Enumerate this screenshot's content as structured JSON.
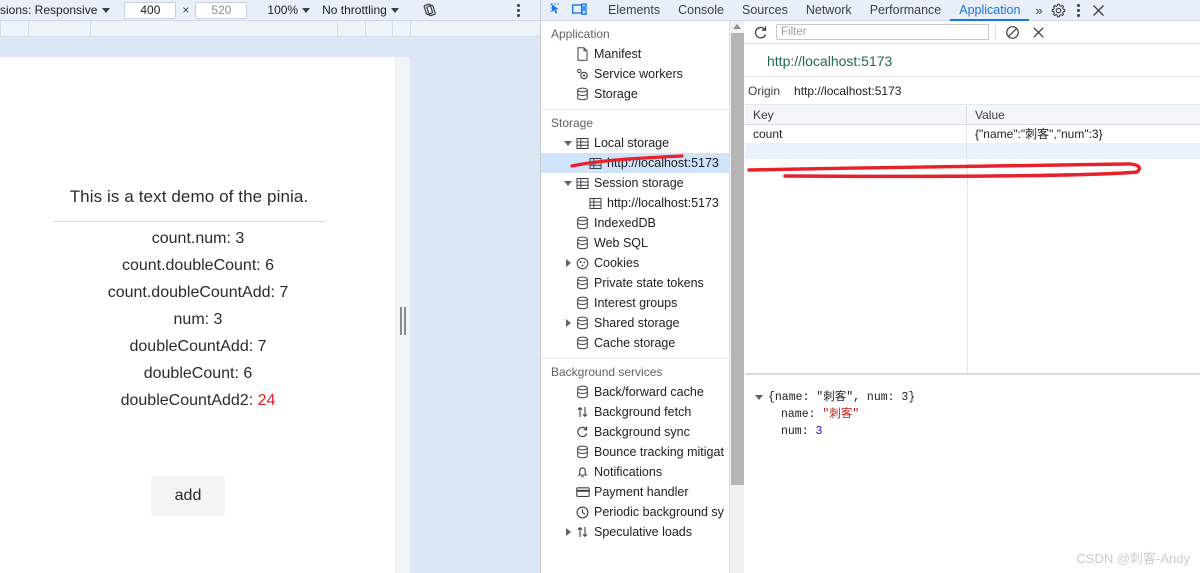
{
  "device_toolbar": {
    "dimensions_label": "sions: Responsive",
    "width_value": "400",
    "height_value": "520",
    "multiply_symbol": "×",
    "zoom_label": "100%",
    "throttling_label": "No throttling",
    "rotate_icon": "rotate-icon",
    "more_icon": "kebab-menu-icon"
  },
  "page": {
    "title": "This is a text demo of the pinia.",
    "stats": [
      {
        "text": "count.num: 3"
      },
      {
        "text": "count.doubleCount: 6"
      },
      {
        "text": "count.doubleCountAdd: 7"
      },
      {
        "text": "num: 3"
      },
      {
        "text": "doubleCountAdd: 7"
      },
      {
        "text": "doubleCount: 6"
      }
    ],
    "accent_stat_label": "doubleCountAdd2: ",
    "accent_stat_value": "24",
    "accent_color": "#e02020",
    "add_button_label": "add"
  },
  "devtools": {
    "inspect_icon": "inspect-element-icon",
    "device_toggle_icon": "device-toolbar-icon",
    "tabs": [
      {
        "label": "Elements",
        "active": false
      },
      {
        "label": "Console",
        "active": false
      },
      {
        "label": "Sources",
        "active": false
      },
      {
        "label": "Network",
        "active": false
      },
      {
        "label": "Performance",
        "active": false
      },
      {
        "label": "Application",
        "active": true
      }
    ],
    "more_tabs_label": "»",
    "settings_icon": "gear-icon",
    "menu_icon": "kebab-menu-icon",
    "close_icon": "close-icon",
    "active_tab_color": "#1a73e8"
  },
  "sidebar": {
    "sections": [
      {
        "title": "Application",
        "items": [
          {
            "label": "Manifest",
            "icon": "document-icon",
            "indent": 1,
            "arrow": "none",
            "selected": false
          },
          {
            "label": "Service workers",
            "icon": "gears-icon",
            "indent": 1,
            "arrow": "none",
            "selected": false
          },
          {
            "label": "Storage",
            "icon": "database-icon",
            "indent": 1,
            "arrow": "none",
            "selected": false
          }
        ]
      },
      {
        "title": "Storage",
        "items": [
          {
            "label": "Local storage",
            "icon": "table-icon",
            "indent": 1,
            "arrow": "open",
            "selected": false
          },
          {
            "label": "http://localhost:5173",
            "icon": "table-icon",
            "indent": 2,
            "arrow": "none",
            "selected": true
          },
          {
            "label": "Session storage",
            "icon": "table-icon",
            "indent": 1,
            "arrow": "open",
            "selected": false
          },
          {
            "label": "http://localhost:5173",
            "icon": "table-icon",
            "indent": 2,
            "arrow": "none",
            "selected": false
          },
          {
            "label": "IndexedDB",
            "icon": "database-icon",
            "indent": 1,
            "arrow": "none",
            "selected": false
          },
          {
            "label": "Web SQL",
            "icon": "database-icon",
            "indent": 1,
            "arrow": "none",
            "selected": false
          },
          {
            "label": "Cookies",
            "icon": "cookie-icon",
            "indent": 1,
            "arrow": "closed",
            "selected": false
          },
          {
            "label": "Private state tokens",
            "icon": "database-icon",
            "indent": 1,
            "arrow": "none",
            "selected": false
          },
          {
            "label": "Interest groups",
            "icon": "database-icon",
            "indent": 1,
            "arrow": "none",
            "selected": false
          },
          {
            "label": "Shared storage",
            "icon": "database-icon",
            "indent": 1,
            "arrow": "closed",
            "selected": false
          },
          {
            "label": "Cache storage",
            "icon": "database-icon",
            "indent": 1,
            "arrow": "none",
            "selected": false
          }
        ]
      },
      {
        "title": "Background services",
        "items": [
          {
            "label": "Back/forward cache",
            "icon": "database-icon",
            "indent": 1,
            "arrow": "none",
            "selected": false
          },
          {
            "label": "Background fetch",
            "icon": "arrows-updown-icon",
            "indent": 1,
            "arrow": "none",
            "selected": false
          },
          {
            "label": "Background sync",
            "icon": "sync-icon",
            "indent": 1,
            "arrow": "none",
            "selected": false
          },
          {
            "label": "Bounce tracking mitigat",
            "icon": "database-icon",
            "indent": 1,
            "arrow": "none",
            "selected": false
          },
          {
            "label": "Notifications",
            "icon": "bell-icon",
            "indent": 1,
            "arrow": "none",
            "selected": false
          },
          {
            "label": "Payment handler",
            "icon": "card-icon",
            "indent": 1,
            "arrow": "none",
            "selected": false
          },
          {
            "label": "Periodic background sy",
            "icon": "clock-icon",
            "indent": 1,
            "arrow": "none",
            "selected": false
          },
          {
            "label": "Speculative loads",
            "icon": "arrows-updown-icon",
            "indent": 1,
            "arrow": "closed",
            "selected": false
          }
        ]
      }
    ]
  },
  "main": {
    "refresh_icon": "refresh-icon",
    "filter_placeholder": "Filter",
    "clear_icon": "clear-icon",
    "delete_icon": "delete-selected-icon",
    "origin_url": "http://localhost:5173",
    "origin_label": "Origin",
    "origin_value": "http://localhost:5173",
    "table": {
      "columns": [
        "Key",
        "Value"
      ],
      "rows": [
        {
          "key": "count",
          "value": "{\"name\":\"刺客\",\"num\":3}"
        }
      ]
    },
    "preview": {
      "summary": "{name: \"刺客\", num: 3}",
      "entries": [
        {
          "key": "name",
          "value": "\"刺客\"",
          "type": "string"
        },
        {
          "key": "num",
          "value": "3",
          "type": "number"
        }
      ]
    }
  },
  "watermark": "CSDN @刺客-Andy"
}
